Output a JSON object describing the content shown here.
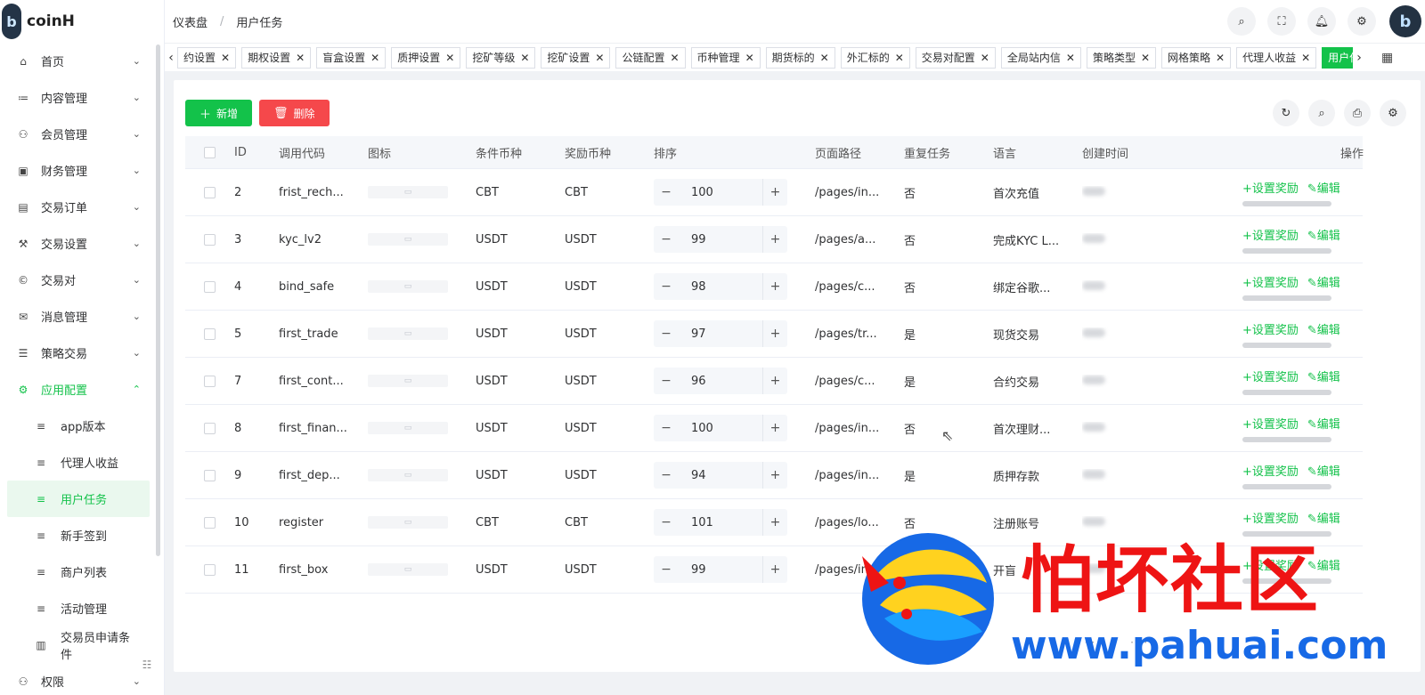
{
  "app": {
    "name": "coinH",
    "logo_letter": "b"
  },
  "header": {
    "breadcrumb": [
      "仪表盘",
      "用户任务"
    ],
    "tools": [
      "search-icon",
      "fullscreen-icon",
      "bell-icon",
      "gear-icon"
    ]
  },
  "sidebar": {
    "items": [
      {
        "label": "首页",
        "icon": "⌂",
        "chev": "⌄"
      },
      {
        "label": "内容管理",
        "icon": "≔",
        "chev": "⌄"
      },
      {
        "label": "会员管理",
        "icon": "⚇",
        "chev": "⌄"
      },
      {
        "label": "财务管理",
        "icon": "▣",
        "chev": "⌄"
      },
      {
        "label": "交易订单",
        "icon": "▤",
        "chev": "⌄"
      },
      {
        "label": "交易设置",
        "icon": "⚒",
        "chev": "⌄"
      },
      {
        "label": "交易对",
        "icon": "©",
        "chev": "⌄"
      },
      {
        "label": "消息管理",
        "icon": "✉",
        "chev": "⌄"
      },
      {
        "label": "策略交易",
        "icon": "☰",
        "chev": "⌄"
      },
      {
        "label": "应用配置",
        "icon": "⚙",
        "chev": "⌃"
      }
    ],
    "sub_items": [
      {
        "label": "app版本",
        "icon": "≡"
      },
      {
        "label": "代理人收益",
        "icon": "≡"
      },
      {
        "label": "用户任务",
        "icon": "≡"
      },
      {
        "label": "新手签到",
        "icon": "≡"
      },
      {
        "label": "商户列表",
        "icon": "≡"
      },
      {
        "label": "活动管理",
        "icon": "≡"
      },
      {
        "label": "交易员申请条件",
        "icon": "▥"
      }
    ],
    "bottom_item": {
      "label": "权限",
      "icon": "⚇",
      "chev": "⌄"
    }
  },
  "tabs": [
    "约设置",
    "期权设置",
    "盲盒设置",
    "质押设置",
    "挖矿等级",
    "挖矿设置",
    "公链配置",
    "币种管理",
    "期货标的",
    "外汇标的",
    "交易对配置",
    "全局站内信",
    "策略类型",
    "网格策略",
    "代理人收益",
    "用户任务"
  ],
  "toolbar": {
    "add_label": "新增",
    "delete_label": "删除"
  },
  "table": {
    "headers": {
      "id": "ID",
      "code": "调用代码",
      "icon": "图标",
      "cond": "条件币种",
      "reward": "奖励币种",
      "sort": "排序",
      "path": "页面路径",
      "repeat": "重复任务",
      "lang": "语言",
      "created": "创建时间",
      "actions": "操作"
    },
    "rows": [
      {
        "id": "2",
        "code": "frist_rech...",
        "cond": "CBT",
        "reward": "CBT",
        "sort": "100",
        "path": "/pages/in...",
        "repeat": "否",
        "lang": "首次充值"
      },
      {
        "id": "3",
        "code": "kyc_lv2",
        "cond": "USDT",
        "reward": "USDT",
        "sort": "99",
        "path": "/pages/a...",
        "repeat": "否",
        "lang": "完成KYC L..."
      },
      {
        "id": "4",
        "code": "bind_safe",
        "cond": "USDT",
        "reward": "USDT",
        "sort": "98",
        "path": "/pages/c...",
        "repeat": "否",
        "lang": "绑定谷歌..."
      },
      {
        "id": "5",
        "code": "first_trade",
        "cond": "USDT",
        "reward": "USDT",
        "sort": "97",
        "path": "/pages/tr...",
        "repeat": "是",
        "lang": "现货交易"
      },
      {
        "id": "7",
        "code": "first_cont...",
        "cond": "USDT",
        "reward": "USDT",
        "sort": "96",
        "path": "/pages/c...",
        "repeat": "是",
        "lang": "合约交易"
      },
      {
        "id": "8",
        "code": "first_finan...",
        "cond": "USDT",
        "reward": "USDT",
        "sort": "100",
        "path": "/pages/in...",
        "repeat": "否",
        "lang": "首次理财..."
      },
      {
        "id": "9",
        "code": "first_dep...",
        "cond": "USDT",
        "reward": "USDT",
        "sort": "94",
        "path": "/pages/in...",
        "repeat": "是",
        "lang": "质押存款"
      },
      {
        "id": "10",
        "code": "register",
        "cond": "CBT",
        "reward": "CBT",
        "sort": "101",
        "path": "/pages/lo...",
        "repeat": "否",
        "lang": "注册账号"
      },
      {
        "id": "11",
        "code": "first_box",
        "cond": "USDT",
        "reward": "USDT",
        "sort": "99",
        "path": "/pages/in...",
        "repeat": "",
        "lang": "开盲"
      }
    ],
    "action_labels": {
      "set_reward": "+设置奖励",
      "edit": "✎编辑"
    }
  },
  "watermark": {
    "cn": "怕坏社区",
    "url": "www.pahuai.com"
  },
  "colors": {
    "accent": "#13c24a",
    "danger": "#f5484b",
    "watermark_red": "#ee1414",
    "watermark_blue": "#1769e6"
  }
}
